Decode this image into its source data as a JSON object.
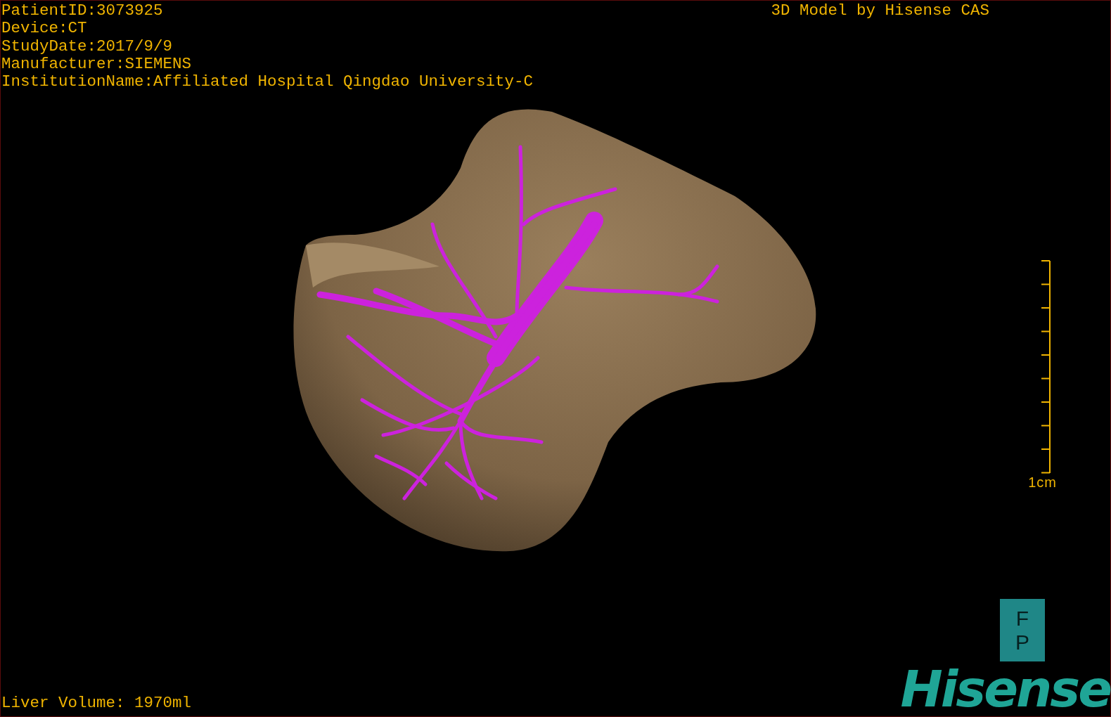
{
  "patient_info": [
    "PatientID:3073925",
    "Device:CT",
    "StudyDate:2017/9/9",
    "Manufacturer:SIEMENS",
    "InstitutionName:Affiliated Hospital Qingdao University-C"
  ],
  "header_title": "3D Model by Hisense CAS",
  "scale_bar": {
    "label": "1cm"
  },
  "liver_volume": "Liver Volume: 1970ml",
  "orientation_marker": [
    "F",
    "P"
  ],
  "logo": "Hisense"
}
